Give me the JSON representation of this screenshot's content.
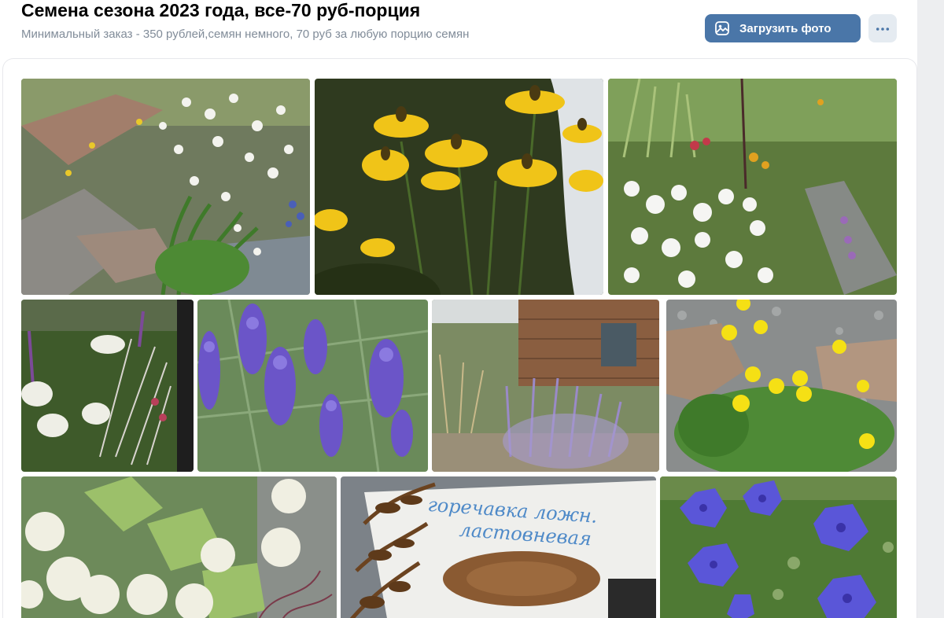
{
  "album": {
    "title": "Семена сезона 2023 года, все-70 руб-порция",
    "description": "Минимальный заказ - 350 рублей,семян немного, 70 руб за любую порцию семян"
  },
  "actions": {
    "upload_label": "Загрузить фото",
    "upload_icon": "photo-upload-icon",
    "more_icon": "more-dots-icon"
  },
  "photos": [
    {
      "name": "photo-white-flowers-rock-garden"
    },
    {
      "name": "photo-yellow-coneflowers"
    },
    {
      "name": "photo-white-bee-balm-garden"
    },
    {
      "name": "photo-veronicastrum-white-umbels"
    },
    {
      "name": "photo-purple-skullcap"
    },
    {
      "name": "photo-perovskia-house"
    },
    {
      "name": "photo-yellow-potentilla"
    },
    {
      "name": "photo-white-clematis-vine"
    },
    {
      "name": "photo-seed-packet"
    },
    {
      "name": "photo-blue-balloon-flowers"
    }
  ],
  "seed_packet": {
    "line1": "горечавка ложн.",
    "line2": "ластовневая"
  },
  "colors": {
    "accent": "#4a76a8",
    "secondary_button": "#e5ebf1",
    "description_text": "#818c99"
  }
}
